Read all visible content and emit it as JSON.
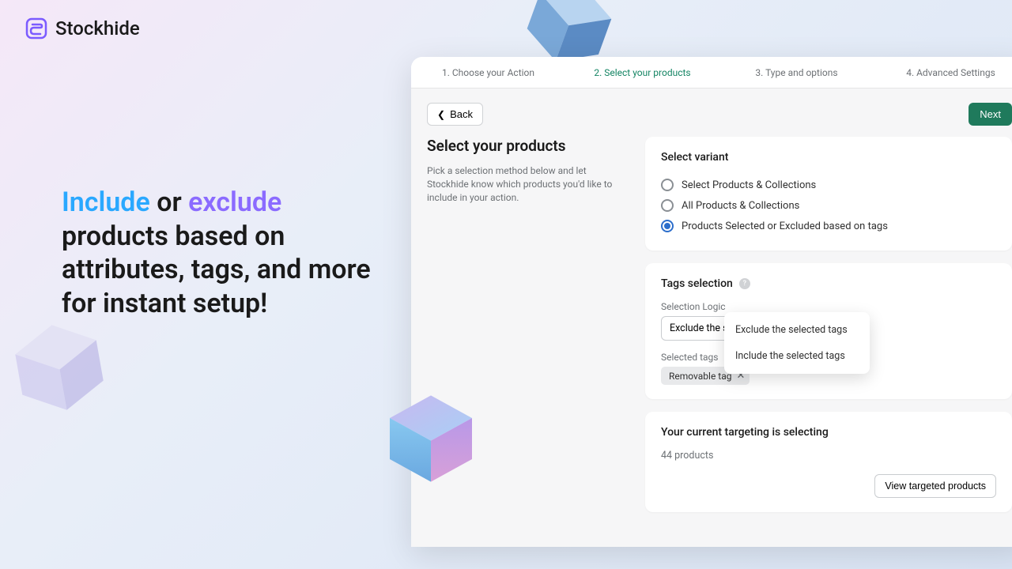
{
  "brand": {
    "name": "Stockhide"
  },
  "tagline": {
    "include": "Include",
    "or": " or ",
    "exclude": "exclude",
    "rest": " products based on attributes, tags, and more for instant setup!"
  },
  "steps": [
    {
      "label": "1. Choose your Action"
    },
    {
      "label": "2. Select your products"
    },
    {
      "label": "3. Type and options"
    },
    {
      "label": "4. Advanced Settings"
    }
  ],
  "nav": {
    "back": "Back",
    "next": "Next"
  },
  "page": {
    "title": "Select your products",
    "subtitle": "Pick a selection method below and let Stockhide know which products you'd like to include in your action."
  },
  "variant": {
    "heading": "Select variant",
    "options": [
      "Select Products & Collections",
      "All Products & Collections",
      "Products Selected or Excluded based on tags"
    ],
    "selectedIndex": 2
  },
  "tags": {
    "heading": "Tags selection",
    "logicLabel": "Selection Logic",
    "logicValue": "Exclude the selected tags",
    "dropdown": [
      "Exclude the selected tags",
      "Include the selected tags"
    ],
    "selectedLabel": "Selected tags",
    "chip": "Removable tag"
  },
  "targeting": {
    "heading": "Your current targeting is selecting",
    "result": "44 products",
    "viewButton": "View targeted products"
  }
}
